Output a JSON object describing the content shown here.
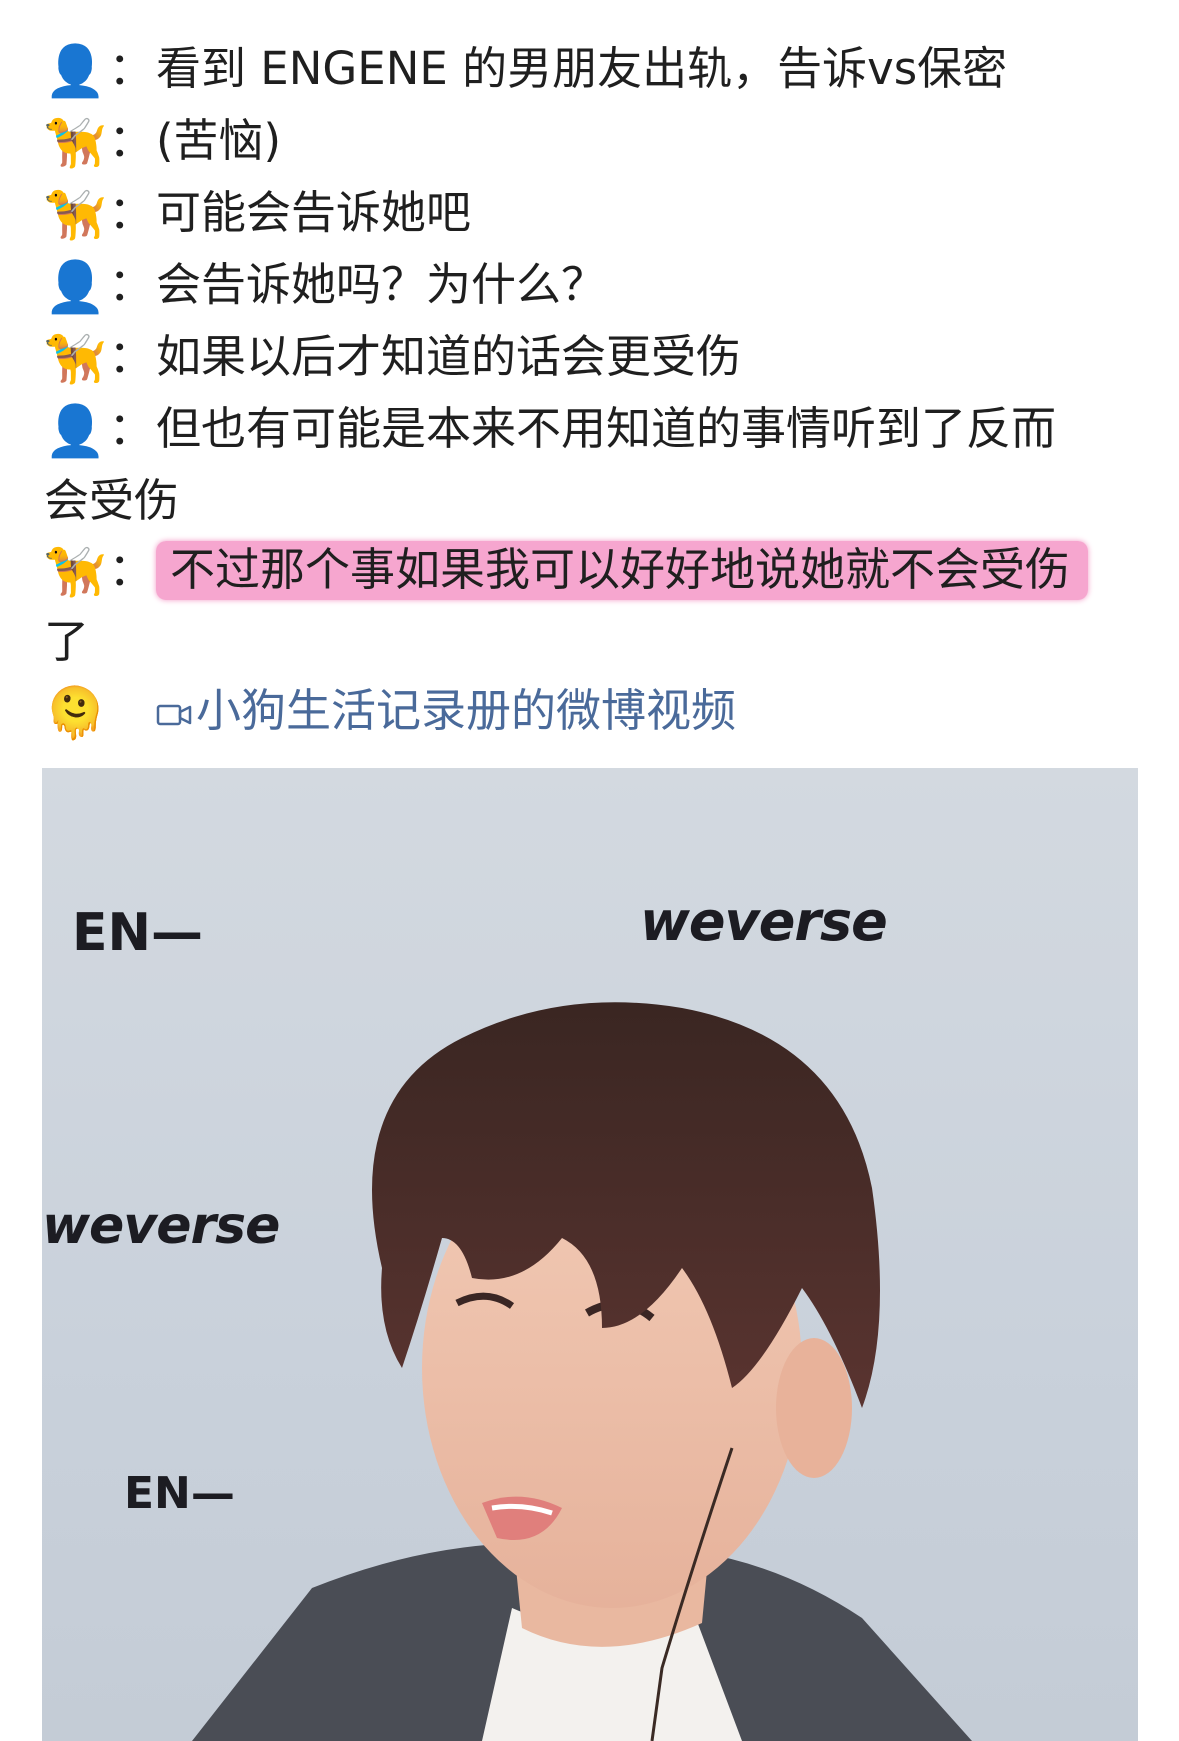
{
  "post": {
    "lines": [
      {
        "speaker_icon": "person-silhouette-icon",
        "glyph": "👤",
        "text": "看到 ENGENE 的男朋友出轨，告诉vs保密"
      },
      {
        "speaker_icon": "guide-dog-icon",
        "glyph": "🦮",
        "text": "(苦恼)"
      },
      {
        "speaker_icon": "guide-dog-icon",
        "glyph": "🦮",
        "text": "可能会告诉她吧"
      },
      {
        "speaker_icon": "person-silhouette-icon",
        "glyph": "👤",
        "text": "会告诉她吗？为什么？"
      },
      {
        "speaker_icon": "guide-dog-icon",
        "glyph": "🦮",
        "text": "如果以后才知道的话会更受伤"
      },
      {
        "speaker_icon": "person-silhouette-icon",
        "glyph": "👤",
        "text": "但也有可能是本来不用知道的事情听到了反而",
        "continuation": "会受伤"
      },
      {
        "speaker_icon": "guide-dog-icon",
        "glyph": "🦮",
        "text": "不过那个事如果我可以好好地说她就不会受伤",
        "continuation": "了",
        "highlight": "#f6a6cf"
      }
    ],
    "separator": "：",
    "footer_emoji": "🫠",
    "video_link_label": "小狗生活记录册的微博视频",
    "link_color": "#4a6a9a"
  },
  "photo": {
    "watermarks": {
      "en_top": "EN—",
      "weverse_top": "weverse",
      "weverse_left": "weverse",
      "en_bottom": "EN—"
    }
  }
}
